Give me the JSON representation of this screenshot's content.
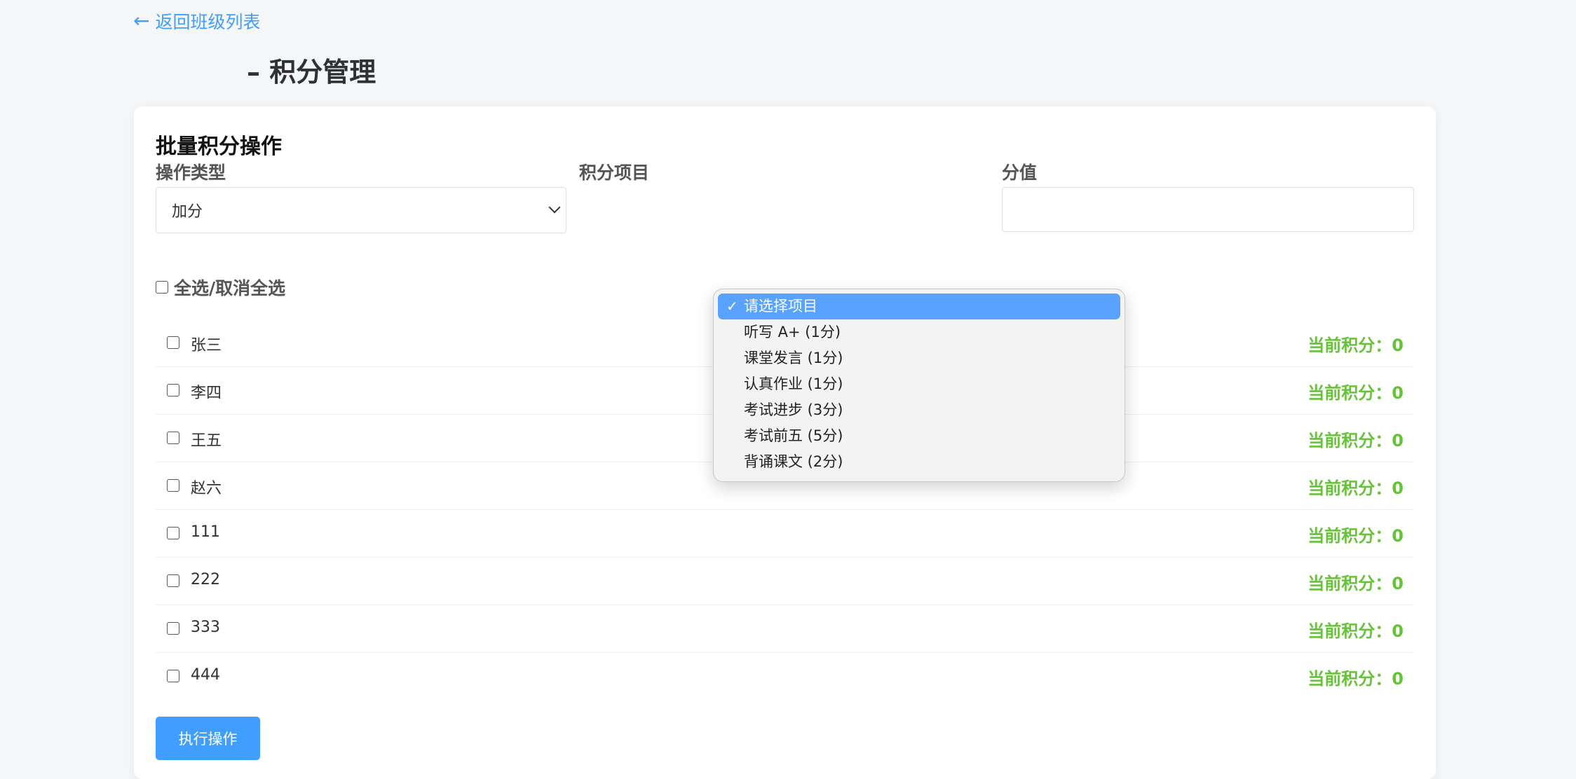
{
  "back_link": {
    "arrow": "←",
    "label": "返回班级列表"
  },
  "page_title": "– 积分管理",
  "batch": {
    "title": "批量积分操作",
    "operation_type_label": "操作类型",
    "operation_type_value": "加分",
    "item_label": "积分项目",
    "value_label": "分值",
    "value_input": ""
  },
  "select_all_label": "全选/取消全选",
  "score_prefix": "当前积分：",
  "students": [
    {
      "name": "张三",
      "score": "当前积分：0"
    },
    {
      "name": "李四",
      "score": "当前积分：0"
    },
    {
      "name": "王五",
      "score": "当前积分：0"
    },
    {
      "name": "赵六",
      "score": "当前积分：0"
    },
    {
      "name": "111",
      "score": "当前积分：0"
    },
    {
      "name": "222",
      "score": "当前积分：0"
    },
    {
      "name": "333",
      "score": "当前积分：0"
    },
    {
      "name": "444",
      "score": "当前积分：0"
    }
  ],
  "item_dropdown": {
    "check_mark": "✓",
    "options": [
      {
        "label": "请选择项目",
        "selected": true
      },
      {
        "label": "听写 A+ (1分)",
        "selected": false
      },
      {
        "label": "课堂发言 (1分)",
        "selected": false
      },
      {
        "label": "认真作业 (1分)",
        "selected": false
      },
      {
        "label": "考试进步 (3分)",
        "selected": false
      },
      {
        "label": "考试前五 (5分)",
        "selected": false
      },
      {
        "label": "背诵课文 (2分)",
        "selected": false
      }
    ]
  },
  "execute_button": "执行操作",
  "colors": {
    "accent": "#409eff",
    "score_green": "#67c23a",
    "dropdown_highlight": "#5aa2ff",
    "background": "#f5f6f8"
  }
}
